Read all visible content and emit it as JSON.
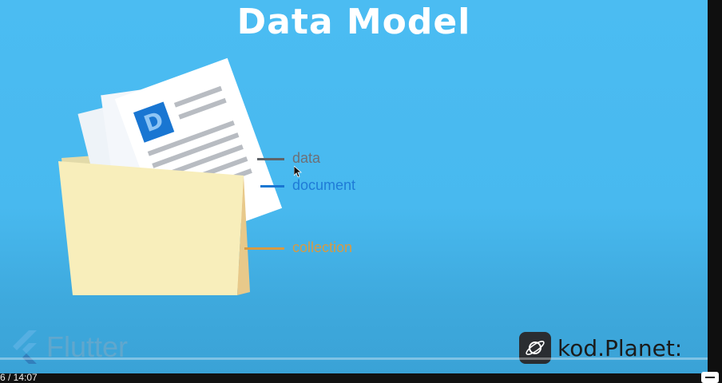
{
  "slide": {
    "title": "Data Model",
    "labels": {
      "data": "data",
      "document": "document",
      "collection": "collection"
    },
    "doc_icon_letter": "D",
    "flutter_text": "Flutter",
    "brand_text": "kod.Planet:"
  },
  "player": {
    "time": "6 / 14:07"
  },
  "colors": {
    "background": "#4bbcf2",
    "data_label": "#6d7077",
    "document_label": "#1f7bd7",
    "collection_label": "#d89a42",
    "folder": "#f7e6b0"
  },
  "icons": {
    "illustration": "folder-with-documents-icon",
    "flutter": "flutter-logo-icon",
    "brand": "planet-logo-icon",
    "fullscreen": "fullscreen-icon"
  }
}
